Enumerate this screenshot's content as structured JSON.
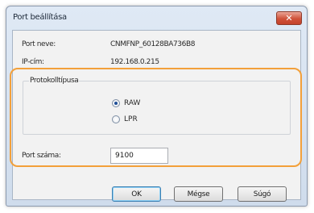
{
  "dialog": {
    "title": "Port beállítása",
    "close_glyph": "✕"
  },
  "fields": {
    "port_name_label": "Port neve:",
    "port_name_value": "CNMFNP_60128BA736B8",
    "ip_label": "IP-cím:",
    "ip_value": "192.168.0.215"
  },
  "protocol": {
    "group_label": "Protokolltípusa",
    "options": [
      {
        "label": "RAW",
        "selected": true
      },
      {
        "label": "LPR",
        "selected": false
      }
    ]
  },
  "port_number": {
    "label": "Port száma:",
    "value": "9100"
  },
  "buttons": {
    "ok": "OK",
    "cancel": "Mégse",
    "help": "Súgó"
  },
  "colors": {
    "highlight": "#f3a03a",
    "close_button": "#d0523a"
  }
}
